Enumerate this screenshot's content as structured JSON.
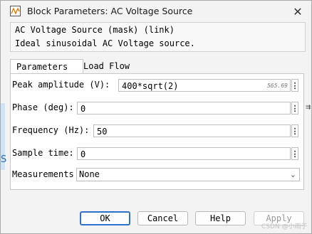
{
  "window": {
    "title": "Block Parameters: AC Voltage Source",
    "close_icon": "close-icon",
    "app_icon": "simulink-block-icon"
  },
  "mask": {
    "title": "AC Voltage Source (mask) (link)",
    "description": "Ideal sinusoidal AC Voltage source."
  },
  "tabs": [
    {
      "label": "Parameters",
      "active": true
    },
    {
      "label": "Load Flow",
      "active": false
    }
  ],
  "params": {
    "peak_amplitude": {
      "label": "Peak amplitude (V):",
      "value": "400*sqrt(2)",
      "eval_hint": "565.69"
    },
    "phase": {
      "label": "Phase (deg):",
      "value": "0"
    },
    "frequency": {
      "label": "Frequency (Hz):",
      "value": "50"
    },
    "sample_time": {
      "label": "Sample time:",
      "value": "0"
    },
    "measurements": {
      "label": "Measurements",
      "value": "None"
    }
  },
  "buttons": {
    "ok": "OK",
    "cancel": "Cancel",
    "help": "Help",
    "apply": "Apply"
  },
  "background": {
    "side_letter": "S",
    "side_symbol": "⇉"
  },
  "watermark": "CSDN @小雨子"
}
